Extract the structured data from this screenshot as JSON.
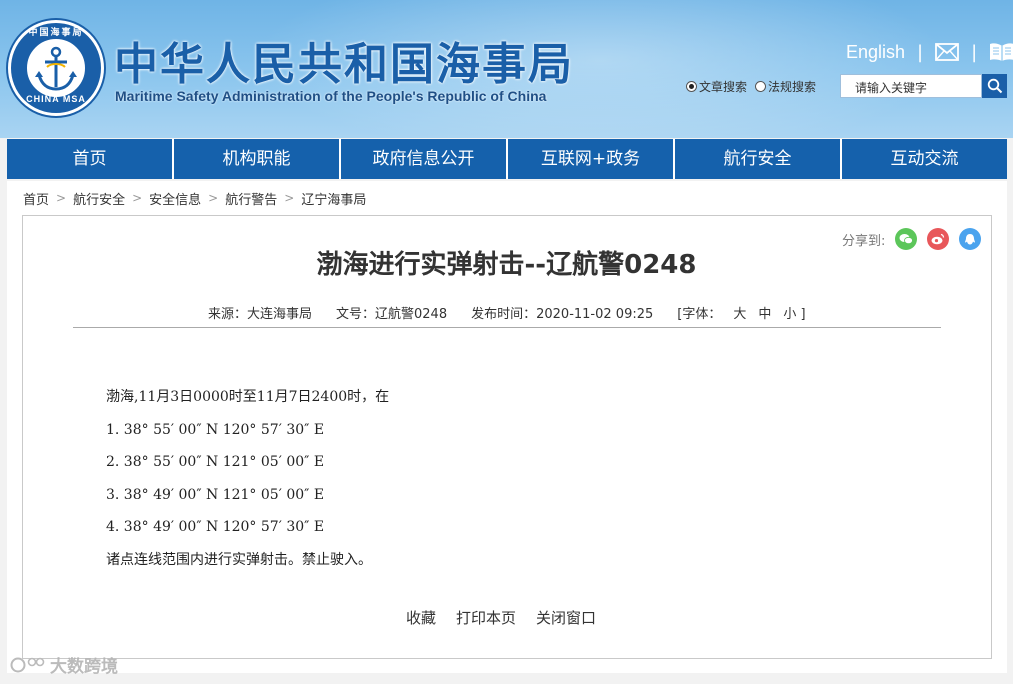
{
  "header": {
    "title_cn": "中华人民共和国海事局",
    "title_en": "Maritime Safety Administration of the People's Republic of China",
    "logo_text_top": "中国海事局",
    "logo_text_bottom": "CHINA MSA",
    "english_link": "English",
    "separator": "|",
    "search": {
      "radio_article": "文章搜索",
      "radio_law": "法规搜索",
      "placeholder": "请输入关键字"
    }
  },
  "nav": [
    "首页",
    "机构职能",
    "政府信息公开",
    "互联网+政务",
    "航行安全",
    "互动交流"
  ],
  "breadcrumb": [
    "首页",
    "航行安全",
    "安全信息",
    "航行警告",
    "辽宁海事局"
  ],
  "breadcrumb_sep": ">",
  "share_label": "分享到:",
  "article": {
    "title": "渤海进行实弹射击--辽航警0248",
    "source": "来源：大连海事局",
    "doc_no": "文号：辽航警0248",
    "published": "发布时间：2020-11-02 09:25",
    "font_label": "[字体：",
    "font_large": "大",
    "font_medium": "中",
    "font_small": "小 ]",
    "body": [
      "渤海,11月3日0000时至11月7日2400时，在",
      "1. 38°  55′ 00″ N   120°  57′ 30″ E",
      "2. 38°  55′ 00″ N   121°  05′ 00″ E",
      "3. 38°  49′ 00″ N   121°  05′ 00″ E",
      "4. 38°  49′ 00″ N   120°  57′ 30″ E",
      "诸点连线范围内进行实弹射击。禁止驶入。"
    ]
  },
  "actions": [
    "收藏",
    "打印本页",
    "关闭窗口"
  ],
  "watermark": "大数跨境",
  "colors": {
    "brand_blue": "#1561ac",
    "wechat": "#5cc65a",
    "weibo": "#e8575a",
    "qq": "#4aa3ee"
  }
}
